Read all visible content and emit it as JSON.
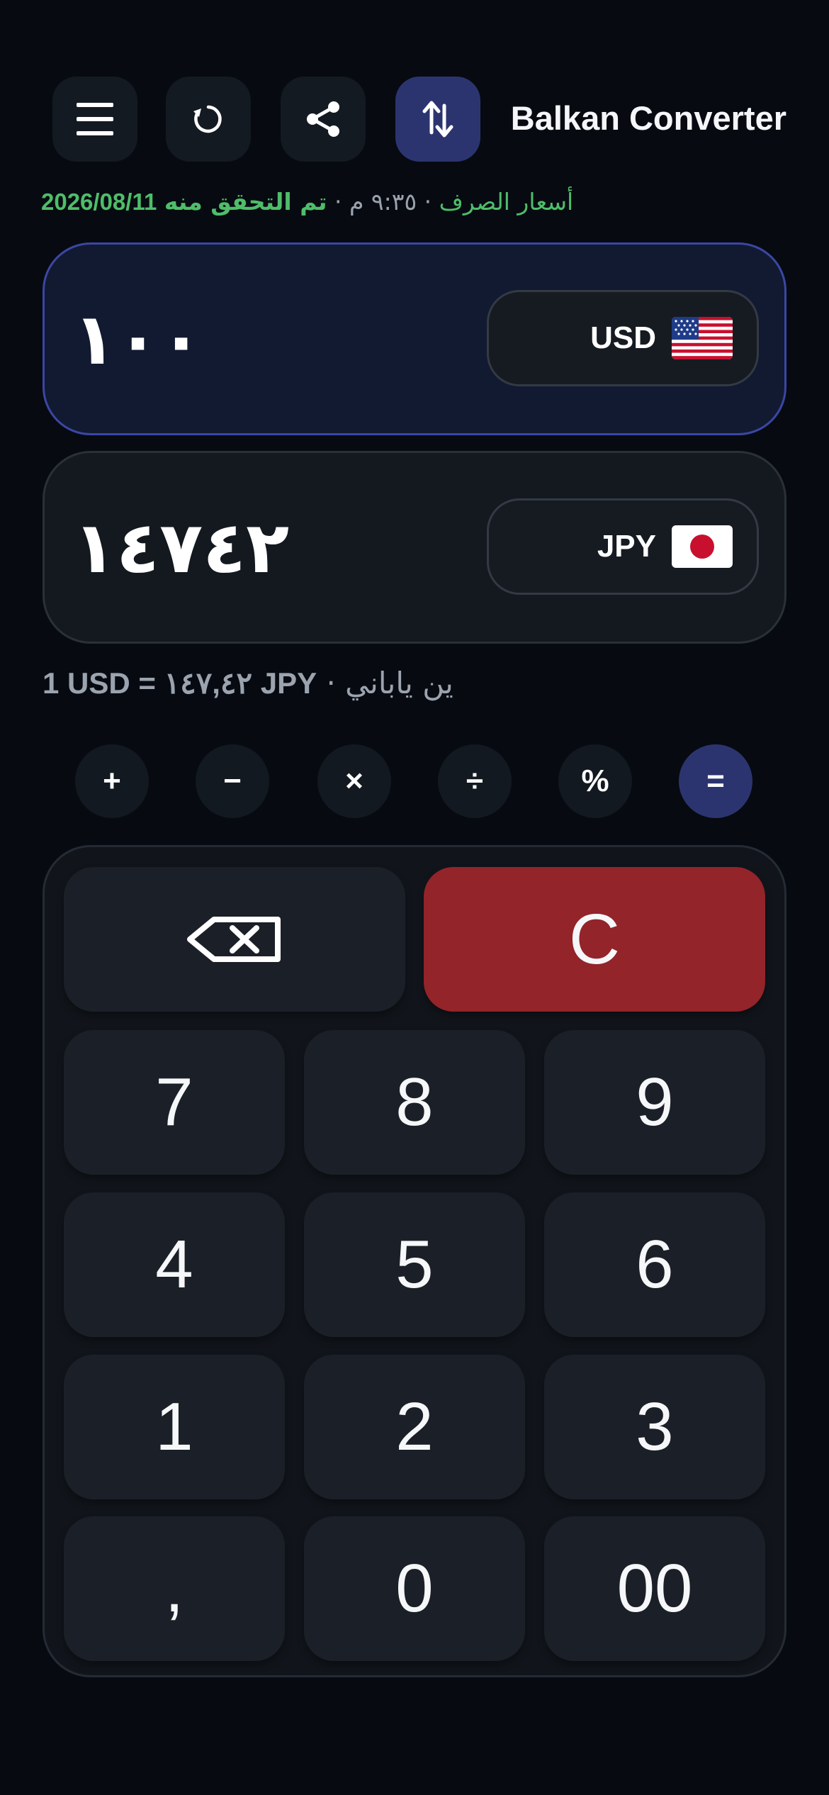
{
  "header": {
    "title": "Balkan Converter",
    "icons": [
      "menu-icon",
      "refresh-icon",
      "share-icon",
      "swap-icon"
    ]
  },
  "status": {
    "verified": "تم التحقق منه",
    "time": "· ٩:٣٥ م ·",
    "rates_label": "أسعار الصرف",
    "date": "2026/08/11"
  },
  "from": {
    "amount": "١٠٠",
    "code": "USD",
    "flag_icon": "us-flag-icon"
  },
  "to": {
    "amount": "١٤٧٤٢",
    "code": "JPY",
    "flag_icon": "jp-flag-icon"
  },
  "rate": {
    "equation": "1 USD = ١٤٧,٤٢ JPY",
    "name": "· ين ياباني"
  },
  "operators": [
    "+",
    "−",
    "×",
    "÷",
    "%",
    "="
  ],
  "keypad": {
    "backspace_icon": "backspace-icon",
    "clear": "C",
    "keys": [
      "7",
      "8",
      "9",
      "4",
      "5",
      "6",
      "1",
      "2",
      "3",
      ",",
      "0",
      "00"
    ]
  },
  "colors": {
    "background": "#070b11",
    "accent": "#2c3470",
    "verified": "#4fbd6a",
    "clear": "#93242a"
  }
}
